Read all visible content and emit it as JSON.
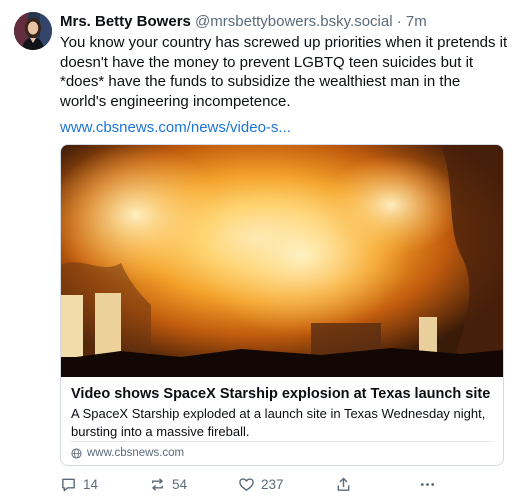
{
  "post": {
    "display_name": "Mrs. Betty Bowers",
    "handle": "@mrsbettybowers.bsky.social",
    "separator": "·",
    "time": "7m",
    "text": "You know your country has screwed up priorities when it pretends it doesn't have the money to prevent LGBTQ teen suicides but it *does* have the funds to subsidize the wealthiest man in the world's engineering incompetence.",
    "link": "www.cbsnews.com/news/video-s..."
  },
  "card": {
    "title": "Video shows SpaceX Starship explosion at Texas launch site",
    "description": "A SpaceX Starship exploded at a launch site in Texas Wednesday night, bursting into a massive fireball.",
    "domain": "www.cbsnews.com",
    "domain_icon": "globe-icon"
  },
  "actions": {
    "reply_count": "14",
    "repost_count": "54",
    "like_count": "237"
  },
  "colors": {
    "link": "#1d74d8",
    "muted": "#5b6a7a",
    "border": "#d4dbe2"
  }
}
